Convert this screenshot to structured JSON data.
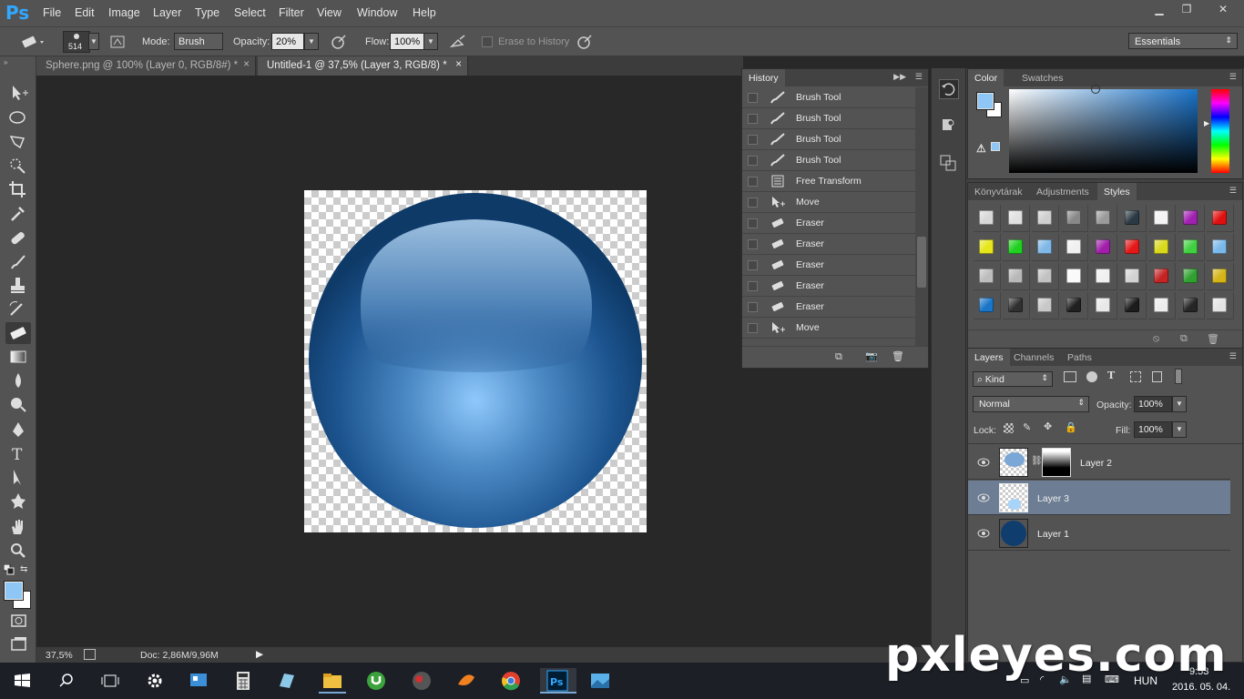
{
  "app": {
    "logo": "Ps"
  },
  "menu": [
    "File",
    "Edit",
    "Image",
    "Layer",
    "Type",
    "Select",
    "Filter",
    "View",
    "Window",
    "Help"
  ],
  "window_controls": {
    "minimize": "▁",
    "restore": "❐",
    "close": "✕"
  },
  "options": {
    "brush_size": "514",
    "mode_label": "Mode:",
    "mode_value": "Brush",
    "opacity_label": "Opacity:",
    "opacity_value": "20%",
    "flow_label": "Flow:",
    "flow_value": "100%",
    "erase_history_label": "Erase to History",
    "workspace": "Essentials"
  },
  "doc_tabs": [
    {
      "title": "Sphere.png @ 100% (Layer 0, RGB/8#) *",
      "close": "×"
    },
    {
      "title": "Untitled-1 @ 37,5% (Layer 3, RGB/8) *",
      "close": "×"
    }
  ],
  "status": {
    "zoom": "37,5%",
    "doc": "Doc: 2,86M/9,96M"
  },
  "history": {
    "title": "History",
    "items": [
      {
        "label": "Brush Tool",
        "icon": "brush-icon"
      },
      {
        "label": "Brush Tool",
        "icon": "brush-icon"
      },
      {
        "label": "Brush Tool",
        "icon": "brush-icon"
      },
      {
        "label": "Brush Tool",
        "icon": "brush-icon"
      },
      {
        "label": "Free Transform",
        "icon": "transform-icon"
      },
      {
        "label": "Move",
        "icon": "move-icon"
      },
      {
        "label": "Eraser",
        "icon": "eraser-icon"
      },
      {
        "label": "Eraser",
        "icon": "eraser-icon"
      },
      {
        "label": "Eraser",
        "icon": "eraser-icon"
      },
      {
        "label": "Eraser",
        "icon": "eraser-icon"
      },
      {
        "label": "Eraser",
        "icon": "eraser-icon"
      },
      {
        "label": "Move",
        "icon": "move-icon"
      }
    ]
  },
  "color_panel": {
    "tabs": [
      "Color",
      "Swatches"
    ],
    "foreground": "#8ec7f5",
    "background": "#ffffff",
    "hue_marker": "#1a73c9"
  },
  "styles_panel": {
    "tabs": [
      "Könyvtárak",
      "Adjustments",
      "Styles"
    ],
    "rows": [
      [
        "#d8d8d8",
        "#e0e0e0",
        "#cfcfcf",
        "#888",
        "#9a9a9a",
        "#2b3a44",
        "#f4f4f4",
        "#a020b0",
        "#e01010"
      ],
      [
        "#e6e61a",
        "#20d020",
        "#7fb8e6",
        "#f0f0f0",
        "#a01ea8",
        "#e41818",
        "#d8d81c",
        "#40d040",
        "#7ab8ea"
      ],
      [
        "#bdbdbd",
        "#b8b8b8",
        "#c2c2c2",
        "#fafafa",
        "#f0f0f0",
        "#d2d2d2",
        "#c42424",
        "#30a030",
        "#d4b418"
      ],
      [
        "#1a76c8",
        "#303030",
        "#c8c8c8",
        "#202020",
        "#e8e8e8",
        "#1c1c1c",
        "#eeeeee",
        "#262626",
        "#e4e4e4"
      ]
    ]
  },
  "layers_panel": {
    "tabs": [
      "Layers",
      "Channels",
      "Paths"
    ],
    "kind": "Kind",
    "blend": "Normal",
    "opacity_label": "Opacity:",
    "opacity": "100%",
    "lock_label": "Lock:",
    "fill_label": "Fill:",
    "fill": "100%",
    "layers": [
      {
        "name": "Layer 2",
        "selected": false
      },
      {
        "name": "Layer 3",
        "selected": true
      },
      {
        "name": "Layer 1",
        "selected": false
      }
    ]
  },
  "taskbar": {
    "lang": "HUN",
    "time": "9:53",
    "date": "2016. 05. 04."
  },
  "watermark": "pxleyes.com"
}
